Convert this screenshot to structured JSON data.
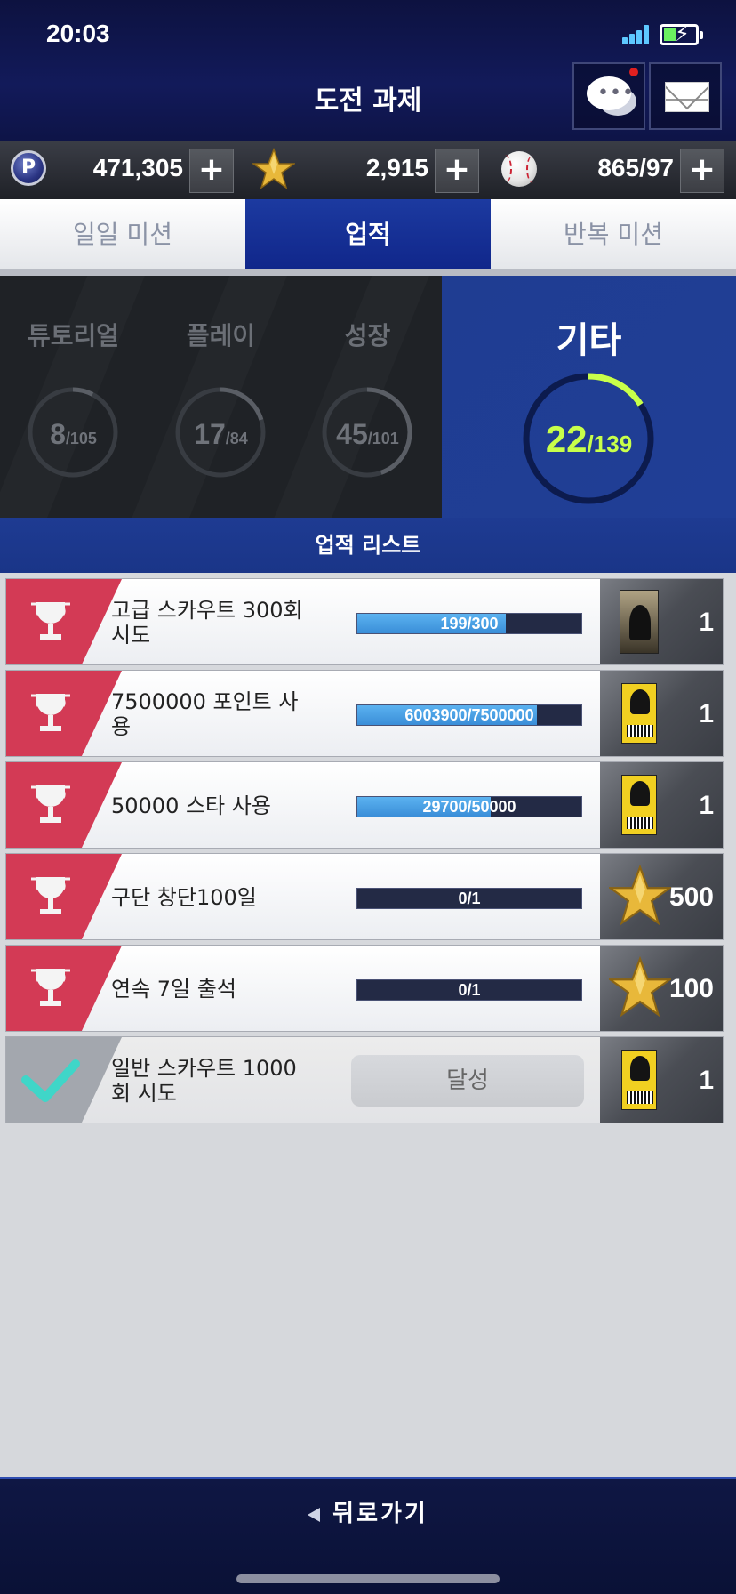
{
  "status": {
    "time": "20:03"
  },
  "header": {
    "title": "도전 과제"
  },
  "currency": {
    "points": "471,305",
    "stars": "2,915",
    "balls": "865/97",
    "p_label": "P"
  },
  "tabs": [
    {
      "label": "일일 미션",
      "selected": false
    },
    {
      "label": "업적",
      "selected": true
    },
    {
      "label": "반복 미션",
      "selected": false
    }
  ],
  "categories": [
    {
      "label": "튜토리얼",
      "done": "8",
      "total": "/105",
      "progress": 0.076
    },
    {
      "label": "플레이",
      "done": "17",
      "total": "/84",
      "progress": 0.202
    },
    {
      "label": "성장",
      "done": "45",
      "total": "/101",
      "progress": 0.446
    }
  ],
  "selected_category": {
    "label": "기타",
    "done": "22",
    "total": "/139",
    "progress": 0.158
  },
  "list_title": "업적 리스트",
  "achievements": [
    {
      "title": "고급 스카우트 300회 시도",
      "progress_text": "199/300",
      "progress": 0.663,
      "reward_icon": "premium-card-icon",
      "reward_qty": "1",
      "completed": false
    },
    {
      "title": "7500000 포인트 사용",
      "progress_text": "6003900/7500000",
      "progress": 0.8,
      "reward_icon": "scout-ticket-icon",
      "reward_qty": "1",
      "completed": false
    },
    {
      "title": "50000 스타 사용",
      "progress_text": "29700/50000",
      "progress": 0.594,
      "reward_icon": "scout-ticket-icon",
      "reward_qty": "1",
      "completed": false
    },
    {
      "title": "구단 창단100일",
      "progress_text": "0/1",
      "progress": 0,
      "reward_icon": "star-icon",
      "reward_qty": "500",
      "completed": false
    },
    {
      "title": "연속 7일 출석",
      "progress_text": "0/1",
      "progress": 0,
      "reward_icon": "star-icon",
      "reward_qty": "100",
      "completed": false
    },
    {
      "title": "일반 스카우트 1000회 시도",
      "done_label": "달성",
      "reward_icon": "scout-ticket-icon",
      "reward_qty": "1",
      "completed": true
    }
  ],
  "footer": {
    "back_label": "뒤로가기"
  },
  "colors": {
    "accent_blue": "#1c3aa0",
    "ring_green": "#c8ff4a",
    "trophy_red": "#d33a55",
    "check_teal": "#3fd6c8"
  }
}
